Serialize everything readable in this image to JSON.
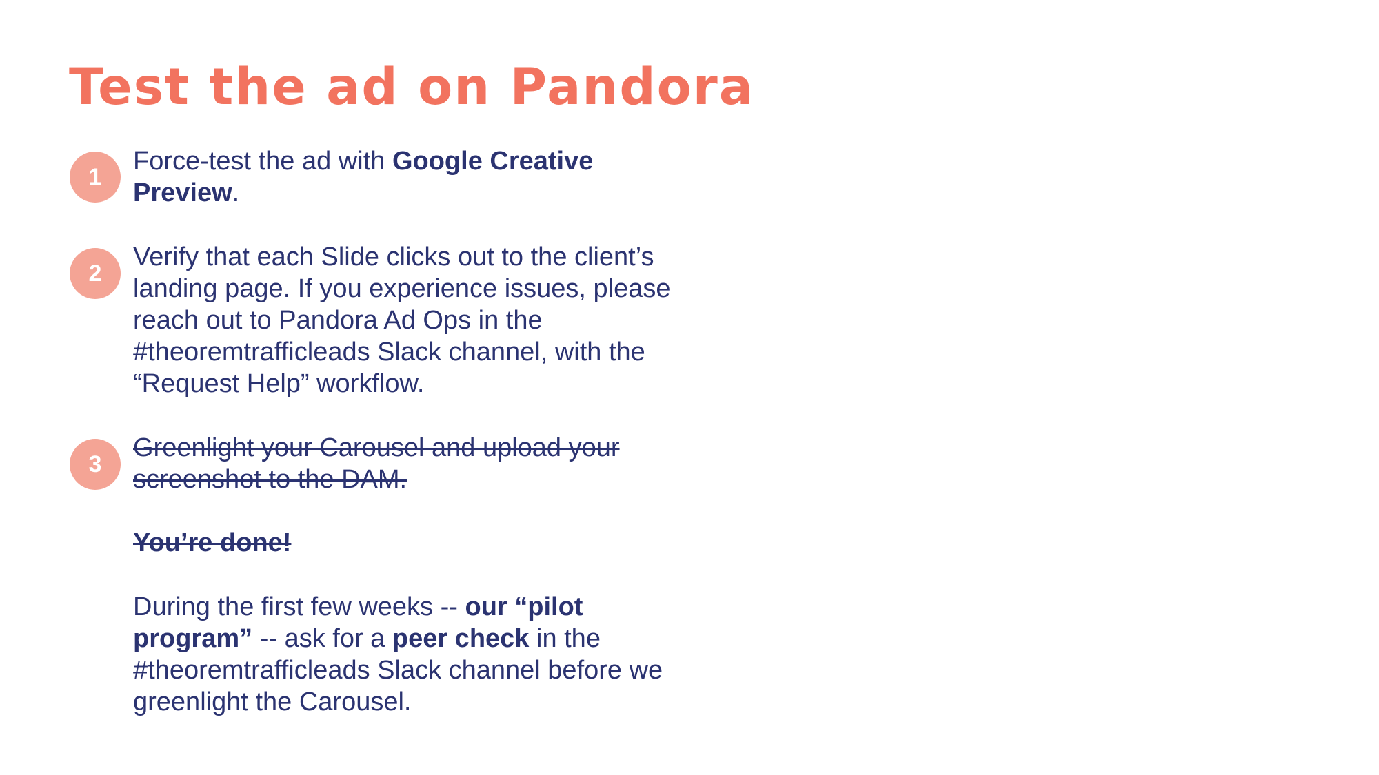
{
  "slide": {
    "title": "Test the ad on Pandora",
    "steps": [
      {
        "number": "1",
        "text_a": "Force-test the ad with ",
        "bold_a": "Google Creative Preview",
        "text_b": "."
      },
      {
        "number": "2",
        "text": "Verify that each Slide clicks out to the client’s landing page. If you experience issues, please reach out to Pandora Ad Ops in the #theoremtrafficleads Slack channel, with the “Request Help” workflow."
      },
      {
        "number": "3",
        "text": "Greenlight your Carousel and upload your screenshot to the DAM."
      }
    ],
    "done_text": "You’re done!",
    "note": {
      "text_a": "During the first few weeks -- ",
      "bold_a": "our “pilot program”",
      "text_b": " -- ask for a ",
      "bold_b": "peer check",
      "text_c": " in the #theoremtrafficleads Slack channel before we greenlight the Carousel."
    }
  },
  "colors": {
    "title": "#f2735f",
    "badge": "#f4a495",
    "body_text": "#2b3371",
    "background": "#ffffff"
  }
}
